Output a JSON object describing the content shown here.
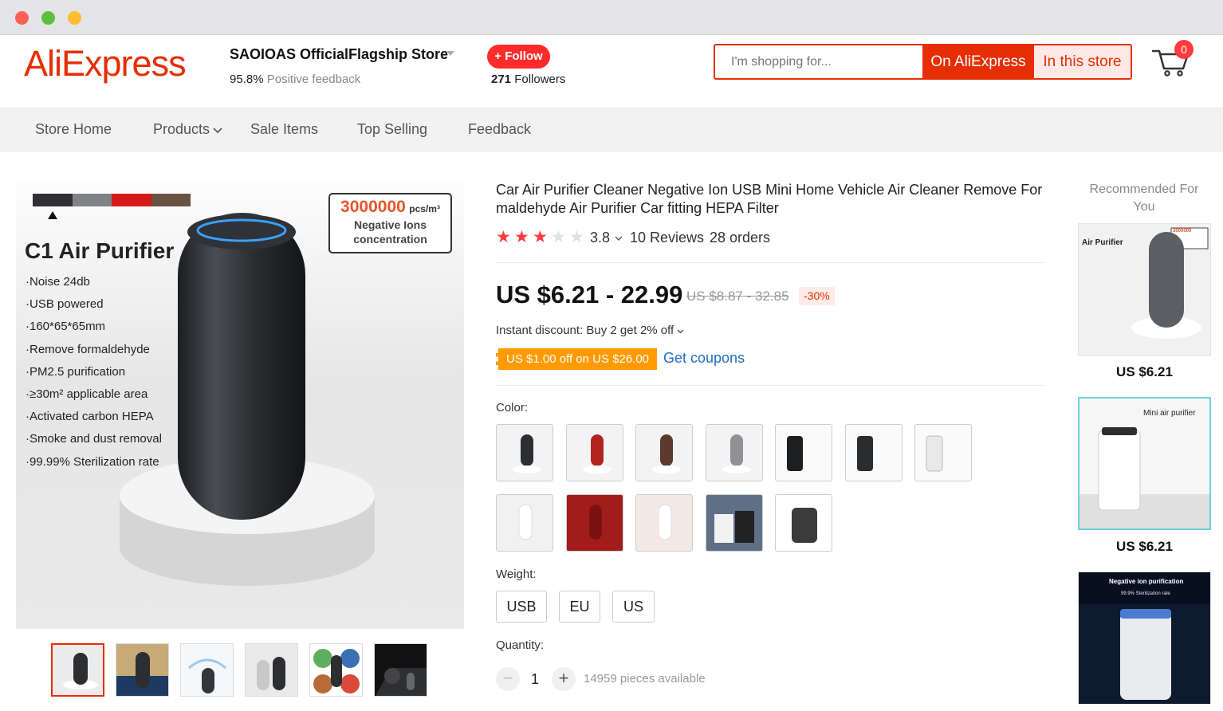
{
  "store": {
    "logo_text": "AliExpress",
    "name": "SAOIOAS OfficialFlagship Store",
    "positive_pct": "95.8%",
    "positive_label": "Positive feedback",
    "follow_label": "+ Follow",
    "followers_count": "271",
    "followers_label": "Followers"
  },
  "search": {
    "placeholder": "I'm shopping for...",
    "on_aliexpress": "On AliExpress",
    "in_store": "In this store"
  },
  "cart": {
    "count": "0"
  },
  "nav": {
    "items": [
      {
        "label": "Store Home"
      },
      {
        "label": "Products"
      },
      {
        "label": "Sale Items"
      },
      {
        "label": "Top Selling"
      },
      {
        "label": "Feedback"
      }
    ]
  },
  "gallery": {
    "badge_number": "3000000",
    "badge_unit": "pcs/m³",
    "badge_line1": "Negative Ions",
    "badge_line2": "concentration",
    "heading": "C1 Air Purifier",
    "features": [
      "·Noise 24db",
      "·USB powered",
      "·160*65*65mm",
      "·Remove formaldehyde",
      "·PM2.5 purification",
      "·≥30m² applicable area",
      "·Activated carbon HEPA",
      "·Smoke and dust removal",
      "·99.99% Sterilization rate"
    ],
    "color_bars": [
      "#2e3033",
      "#808285",
      "#d51a1a",
      "#6a5144"
    ],
    "thumbnail_count": 6
  },
  "product": {
    "title": "Car Air Purifier Cleaner Negative Ion USB Mini Home Vehicle Air Cleaner Remove For maldehyde Air Purifier Car fitting HEPA Filter",
    "rating": "3.8",
    "rating_stars": 3.8,
    "reviews": "10 Reviews",
    "orders": "28 orders",
    "price": "US $6.21 - 22.99",
    "old_price": "US $8.87 - 32.85",
    "discount": "-30%",
    "instant_discount": "Instant discount: Buy 2 get 2% off",
    "coupon": "US $1.00 off on US $26.00",
    "get_coupons": "Get coupons",
    "color_label": "Color:",
    "color_options_count": 12,
    "weight_label": "Weight:",
    "weight_options": [
      "USB",
      "EU",
      "US"
    ],
    "quantity_label": "Quantity:",
    "quantity_value": "1",
    "quantity_minus": "−",
    "quantity_plus": "+",
    "available": "14959 pieces available",
    "accent": "#e62e04",
    "star_color": "#ff3a3a"
  },
  "recommended": {
    "title": "Recommended For You",
    "items": [
      {
        "price": "US $6.21",
        "card_title": "Air Purifier",
        "badge": "3000000"
      },
      {
        "price": "US $6.21",
        "card_title": "Mini air purifier"
      },
      {
        "card_title": "Negative ion purification",
        "sub": "99.9% Sterilization rate"
      }
    ]
  }
}
